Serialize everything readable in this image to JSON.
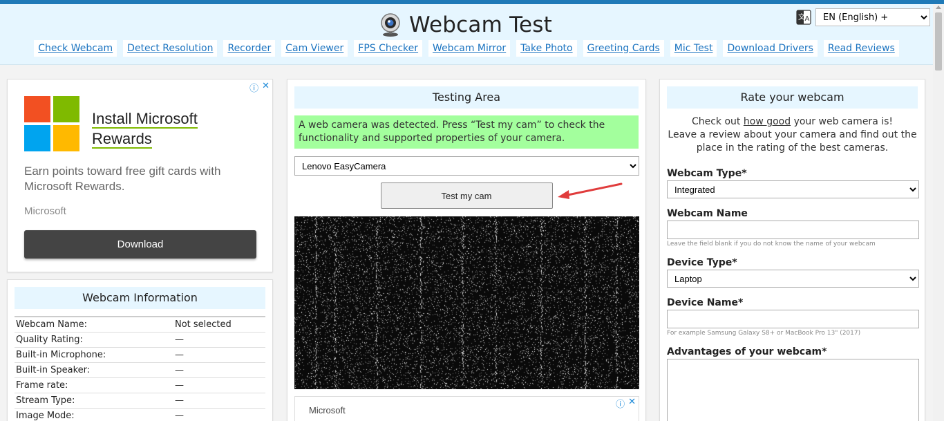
{
  "header": {
    "title": "Webcam Test",
    "language": {
      "selected": "EN (English) +"
    }
  },
  "nav": {
    "items": [
      "Check Webcam",
      "Detect Resolution",
      "Recorder",
      "Cam Viewer",
      "FPS Checker",
      "Webcam Mirror",
      "Take Photo",
      "Greeting Cards",
      "Mic Test",
      "Download Drivers",
      "Read Reviews"
    ]
  },
  "ad_left": {
    "title_line1": "Install Microsoft",
    "title_line2": "Rewards",
    "description": "Earn points toward free gift cards with Microsoft Rewards.",
    "brand": "Microsoft",
    "button": "Download"
  },
  "webcam_info": {
    "title": "Webcam Information",
    "rows": [
      {
        "label": "Webcam Name:",
        "value": "Not selected"
      },
      {
        "label": "Quality Rating:",
        "value": "—"
      },
      {
        "label": "Built-in Microphone:",
        "value": "—"
      },
      {
        "label": "Built-in Speaker:",
        "value": "—"
      },
      {
        "label": "Frame rate:",
        "value": "—"
      },
      {
        "label": "Stream Type:",
        "value": "—"
      },
      {
        "label": "Image Mode:",
        "value": "—"
      }
    ]
  },
  "testing": {
    "title": "Testing Area",
    "notice": "A web camera was detected. Press “Test my cam” to check the functionality and supported properties of your camera.",
    "camera_selected": "Lenovo EasyCamera",
    "test_button": "Test my cam",
    "ad_brand": "Microsoft"
  },
  "rate": {
    "title": "Rate your webcam",
    "intro_before": "Check out ",
    "intro_link": "how good",
    "intro_after": " your web camera is!",
    "intro_line2": "Leave a review about your camera and find out the place in the rating of the best cameras.",
    "webcam_type_label": "Webcam Type*",
    "webcam_type_value": "Integrated",
    "webcam_name_label": "Webcam Name",
    "webcam_name_hint": "Leave the field blank if you do not know the name of your webcam",
    "device_type_label": "Device Type*",
    "device_type_value": "Laptop",
    "device_name_label": "Device Name*",
    "device_name_hint": "For example Samsung Galaxy S8+ or MacBook Pro 13\" (2017)",
    "advantages_label": "Advantages of your webcam*"
  },
  "colors": {
    "accent": "#1f7ab8",
    "header_bg": "#e6f6ff",
    "link": "#1a73c0",
    "notice_bg": "#a3ff9d",
    "arrow": "#e03c3c"
  },
  "icons": {
    "brand": "webcam-icon",
    "language": "translate-icon",
    "ad_choices": "adchoices-icon",
    "ad_close": "close-icon"
  }
}
